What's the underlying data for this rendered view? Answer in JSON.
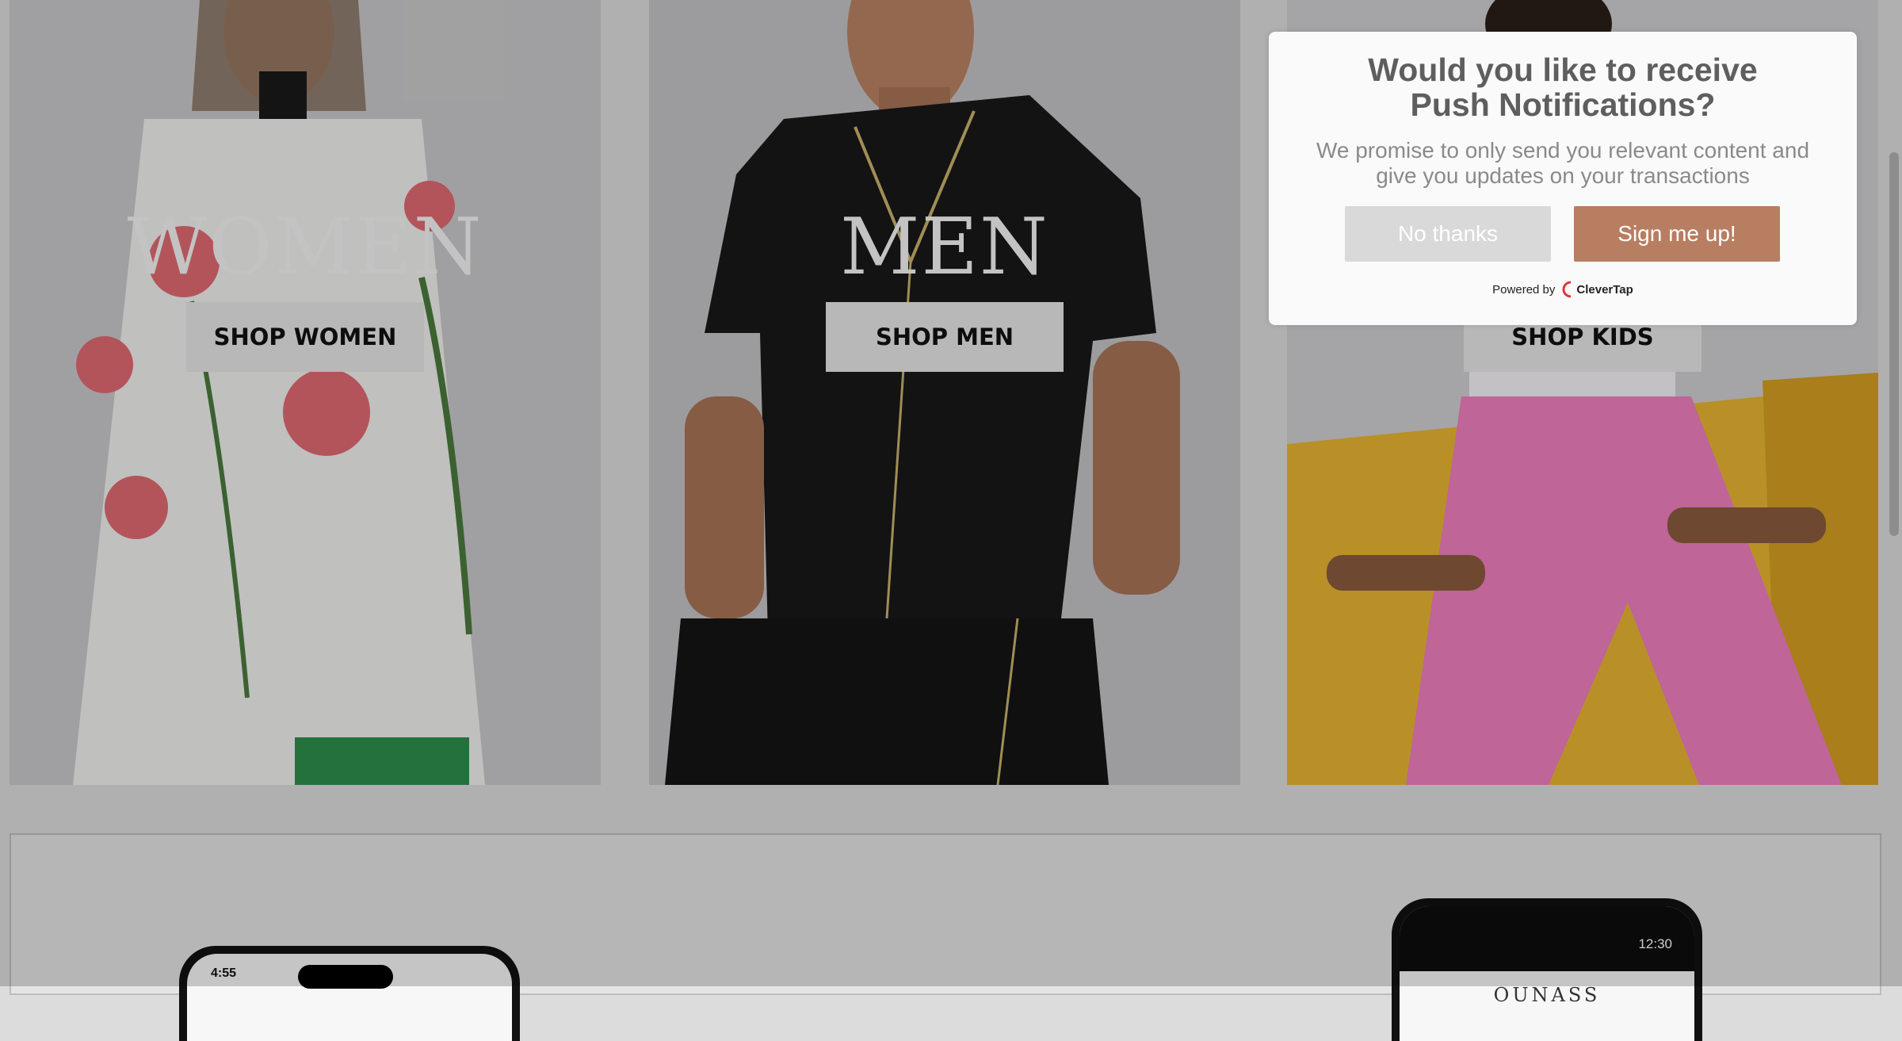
{
  "tiles": {
    "women": {
      "heading": "WOMEN",
      "button": "SHOP WOMEN"
    },
    "men": {
      "heading": "MEN",
      "button": "SHOP MEN"
    },
    "kids": {
      "button": "SHOP KIDS"
    }
  },
  "dialog": {
    "title_line1": "Would you like to receive",
    "title_line2": "Push Notifications?",
    "body": "We promise to only send you relevant content and give you updates on your transactions",
    "no_label": "No thanks",
    "yes_label": "Sign me up!",
    "powered_by": "Powered by",
    "brand": "CleverTap"
  },
  "app_section": {
    "left_phone_time": "4:55",
    "right_phone_time": "12:30",
    "right_phone_logo": "OUNASS"
  },
  "colors": {
    "accent": "#b87e62",
    "no_button": "#d9d9d9",
    "brand_red": "#e2343c"
  }
}
